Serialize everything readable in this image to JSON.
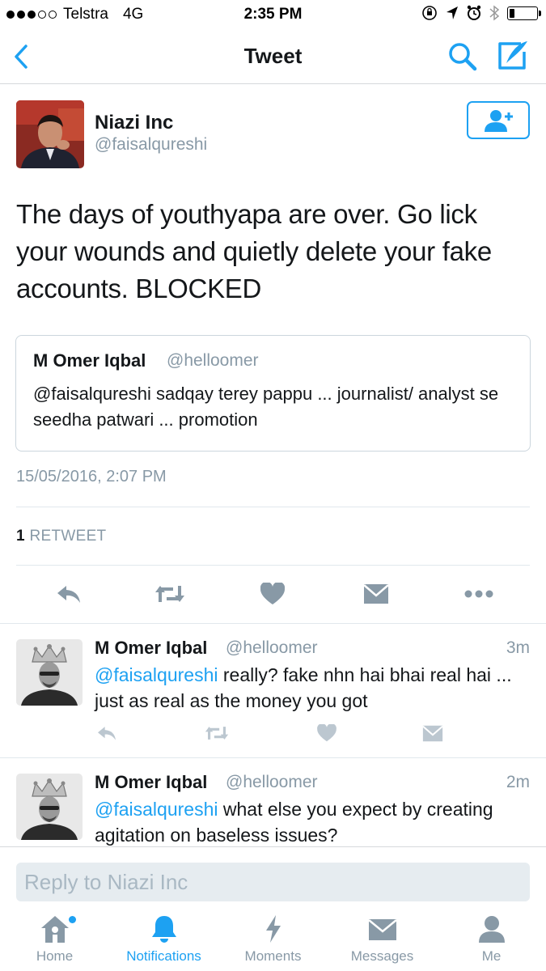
{
  "status_bar": {
    "carrier": "Telstra",
    "network": "4G",
    "time": "2:35 PM",
    "signal_bars_filled": 3,
    "signal_bars_total": 5,
    "battery_level": 0.2
  },
  "nav": {
    "title": "Tweet",
    "back_icon": "chevron-left-icon",
    "search_icon": "search-icon",
    "compose_icon": "compose-tweet-icon"
  },
  "tweet": {
    "name": "Niazi Inc",
    "handle": "@faisalqureshi",
    "text": "The days of youthyapa are over.  Go lick your wounds and quietly delete your fake accounts. BLOCKED",
    "quote": {
      "name": "M Omer Iqbal",
      "handle": "@helloomer",
      "text": "@faisalqureshi sadqay terey pappu ... journalist/ analyst se seedha patwari ... promotion"
    },
    "timestamp": "15/05/2016, 2:07 PM",
    "retweet_count": "1",
    "retweet_label": "RETWEET"
  },
  "replies": [
    {
      "name": "M Omer Iqbal",
      "handle": "@helloomer",
      "time": "3m",
      "mention": "@faisalqureshi",
      "text": " really? fake nhn hai bhai real hai ... just as real as the money you got"
    },
    {
      "name": "M Omer Iqbal",
      "handle": "@helloomer",
      "time": "2m",
      "mention": "@faisalqureshi",
      "text": " what else you expect by creating agitation on baseless issues?"
    }
  ],
  "reply_bar": {
    "placeholder": "Reply to Niazi Inc"
  },
  "tabs": [
    {
      "label": "Home",
      "icon": "home-icon",
      "has_badge": true
    },
    {
      "label": "Notifications",
      "icon": "bell-icon",
      "active": true
    },
    {
      "label": "Moments",
      "icon": "lightning-icon"
    },
    {
      "label": "Messages",
      "icon": "envelope-icon"
    },
    {
      "label": "Me",
      "icon": "person-icon"
    }
  ],
  "colors": {
    "accent": "#1da1f2",
    "secondary_text": "#8899a6",
    "primary_text": "#14171a",
    "action_icon": "#8899a6"
  }
}
